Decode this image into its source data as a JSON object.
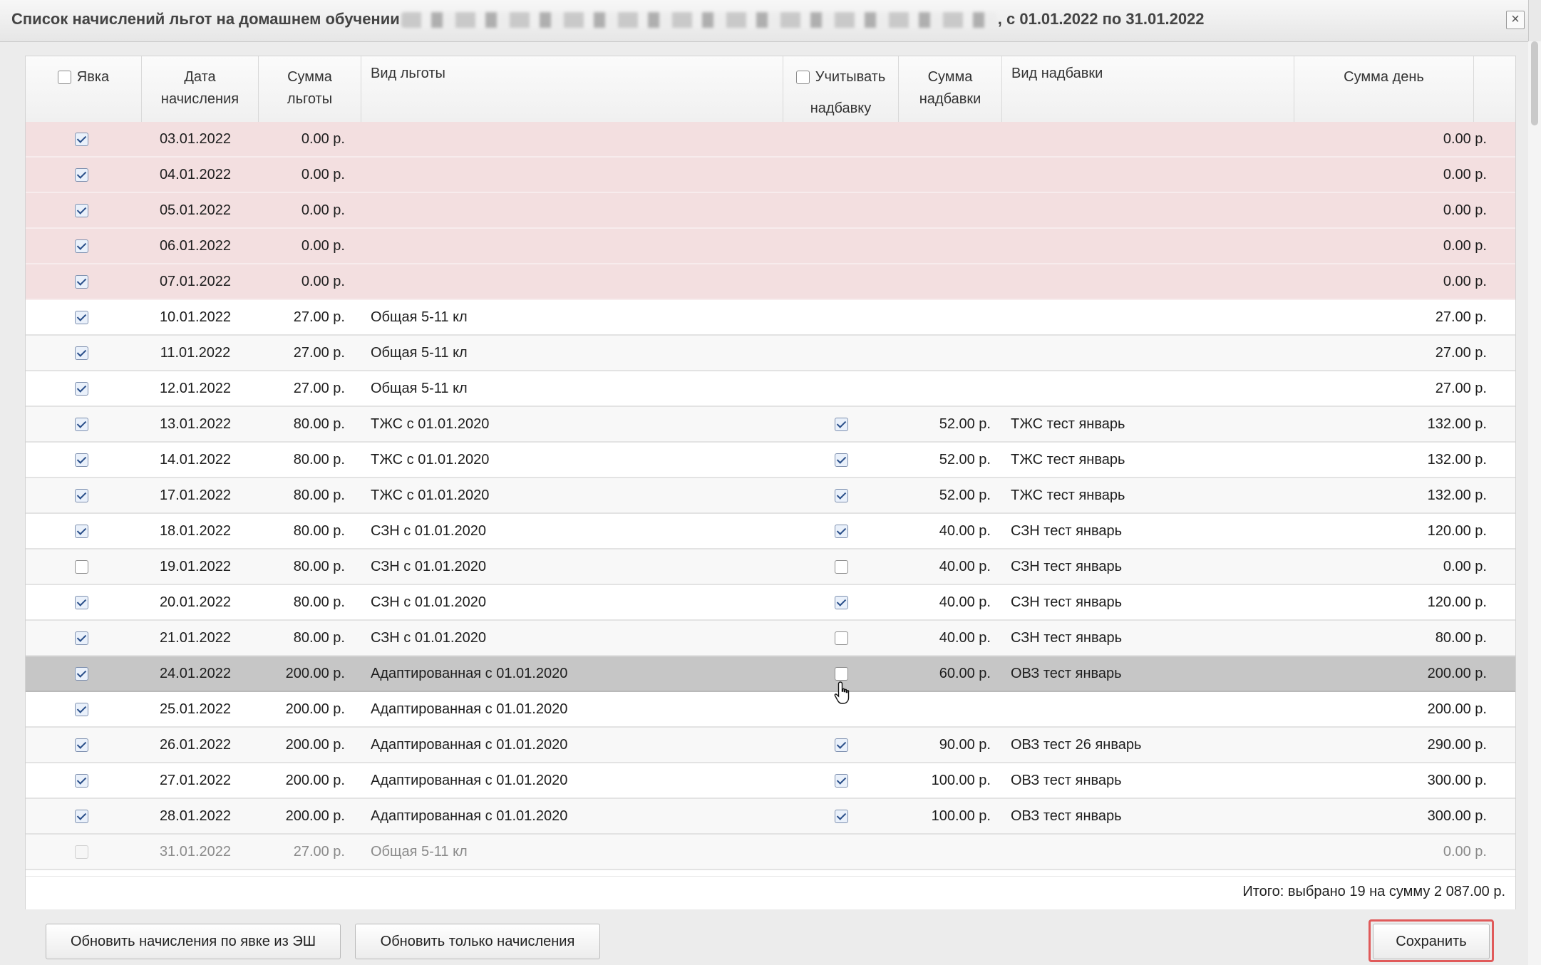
{
  "dialog": {
    "title_prefix": "Список начислений льгот на домашнем обучении",
    "title_suffix": ", с 01.01.2022 по 31.01.2022",
    "close_label": "×"
  },
  "table": {
    "headers": {
      "attendance": "Явка",
      "date_line1": "Дата",
      "date_line2": "начисления",
      "sum_line1": "Сумма",
      "sum_line2": "льготы",
      "benefit_type": "Вид льготы",
      "add_line1": "Учитывать",
      "add_line2": "надбавку",
      "addsum_line1": "Сумма",
      "addsum_line2": "надбавки",
      "add_type": "Вид надбавки",
      "day_sum": "Сумма день"
    },
    "rows": [
      {
        "date": "03.01.2022",
        "sum": "0.00 р.",
        "type": "",
        "add_sum": "",
        "add_type": "",
        "day": "0.00 р.",
        "checked": true,
        "add_checked": null,
        "style": "pink"
      },
      {
        "date": "04.01.2022",
        "sum": "0.00 р.",
        "type": "",
        "add_sum": "",
        "add_type": "",
        "day": "0.00 р.",
        "checked": true,
        "add_checked": null,
        "style": "pink"
      },
      {
        "date": "05.01.2022",
        "sum": "0.00 р.",
        "type": "",
        "add_sum": "",
        "add_type": "",
        "day": "0.00 р.",
        "checked": true,
        "add_checked": null,
        "style": "pink"
      },
      {
        "date": "06.01.2022",
        "sum": "0.00 р.",
        "type": "",
        "add_sum": "",
        "add_type": "",
        "day": "0.00 р.",
        "checked": true,
        "add_checked": null,
        "style": "pink"
      },
      {
        "date": "07.01.2022",
        "sum": "0.00 р.",
        "type": "",
        "add_sum": "",
        "add_type": "",
        "day": "0.00 р.",
        "checked": true,
        "add_checked": null,
        "style": "pink"
      },
      {
        "date": "10.01.2022",
        "sum": "27.00 р.",
        "type": "Общая 5-11 кл",
        "add_sum": "",
        "add_type": "",
        "day": "27.00 р.",
        "checked": true,
        "add_checked": null,
        "style": "white"
      },
      {
        "date": "11.01.2022",
        "sum": "27.00 р.",
        "type": "Общая 5-11 кл",
        "add_sum": "",
        "add_type": "",
        "day": "27.00 р.",
        "checked": true,
        "add_checked": null,
        "style": "stripe"
      },
      {
        "date": "12.01.2022",
        "sum": "27.00 р.",
        "type": "Общая 5-11 кл",
        "add_sum": "",
        "add_type": "",
        "day": "27.00 р.",
        "checked": true,
        "add_checked": null,
        "style": "white"
      },
      {
        "date": "13.01.2022",
        "sum": "80.00 р.",
        "type": "ТЖС с 01.01.2020",
        "add_sum": "52.00 р.",
        "add_type": "ТЖС тест январь",
        "day": "132.00 р.",
        "checked": true,
        "add_checked": true,
        "style": "stripe"
      },
      {
        "date": "14.01.2022",
        "sum": "80.00 р.",
        "type": "ТЖС с 01.01.2020",
        "add_sum": "52.00 р.",
        "add_type": "ТЖС тест январь",
        "day": "132.00 р.",
        "checked": true,
        "add_checked": true,
        "style": "white"
      },
      {
        "date": "17.01.2022",
        "sum": "80.00 р.",
        "type": "ТЖС с 01.01.2020",
        "add_sum": "52.00 р.",
        "add_type": "ТЖС тест январь",
        "day": "132.00 р.",
        "checked": true,
        "add_checked": true,
        "style": "stripe"
      },
      {
        "date": "18.01.2022",
        "sum": "80.00 р.",
        "type": "СЗН с 01.01.2020",
        "add_sum": "40.00 р.",
        "add_type": "СЗН тест январь",
        "day": "120.00 р.",
        "checked": true,
        "add_checked": true,
        "style": "white"
      },
      {
        "date": "19.01.2022",
        "sum": "80.00 р.",
        "type": "СЗН с 01.01.2020",
        "add_sum": "40.00 р.",
        "add_type": "СЗН тест январь",
        "day": "0.00 р.",
        "checked": false,
        "add_checked": false,
        "style": "stripe"
      },
      {
        "date": "20.01.2022",
        "sum": "80.00 р.",
        "type": "СЗН с 01.01.2020",
        "add_sum": "40.00 р.",
        "add_type": "СЗН тест январь",
        "day": "120.00 р.",
        "checked": true,
        "add_checked": true,
        "style": "white"
      },
      {
        "date": "21.01.2022",
        "sum": "80.00 р.",
        "type": "СЗН с 01.01.2020",
        "add_sum": "40.00 р.",
        "add_type": "СЗН тест январь",
        "day": "80.00 р.",
        "checked": true,
        "add_checked": false,
        "style": "stripe"
      },
      {
        "date": "24.01.2022",
        "sum": "200.00 р.",
        "type": "Адаптированная с 01.01.2020",
        "add_sum": "60.00 р.",
        "add_type": "ОВЗ тест январь",
        "day": "200.00 р.",
        "checked": true,
        "add_checked": false,
        "style": "selected"
      },
      {
        "date": "25.01.2022",
        "sum": "200.00 р.",
        "type": "Адаптированная с 01.01.2020",
        "add_sum": "",
        "add_type": "",
        "day": "200.00 р.",
        "checked": true,
        "add_checked": null,
        "style": "white"
      },
      {
        "date": "26.01.2022",
        "sum": "200.00 р.",
        "type": "Адаптированная с 01.01.2020",
        "add_sum": "90.00 р.",
        "add_type": "ОВЗ тест 26 январь",
        "day": "290.00 р.",
        "checked": true,
        "add_checked": true,
        "style": "stripe"
      },
      {
        "date": "27.01.2022",
        "sum": "200.00 р.",
        "type": "Адаптированная с 01.01.2020",
        "add_sum": "100.00 р.",
        "add_type": "ОВЗ тест январь",
        "day": "300.00 р.",
        "checked": true,
        "add_checked": true,
        "style": "white"
      },
      {
        "date": "28.01.2022",
        "sum": "200.00 р.",
        "type": "Адаптированная с 01.01.2020",
        "add_sum": "100.00 р.",
        "add_type": "ОВЗ тест январь",
        "day": "300.00 р.",
        "checked": true,
        "add_checked": true,
        "style": "stripe"
      },
      {
        "date": "31.01.2022",
        "sum": "27.00 р.",
        "type": "Общая 5-11 кл",
        "add_sum": "",
        "add_type": "",
        "day": "0.00 р.",
        "checked": false,
        "add_checked": null,
        "style": "disabled"
      }
    ],
    "total": "Итого: выбрано 19 на сумму 2 087.00 р."
  },
  "buttons": {
    "update_from_attendance": "Обновить начисления по явке из ЭШ",
    "update_only": "Обновить только начисления",
    "save": "Сохранить"
  },
  "colors": {
    "holiday_row": "#f3dfe0",
    "selected_row": "#c6c6c6",
    "save_highlight": "#e05a5a"
  },
  "icons": {
    "close": "close-icon",
    "cursor": "hand-pointer-icon"
  }
}
